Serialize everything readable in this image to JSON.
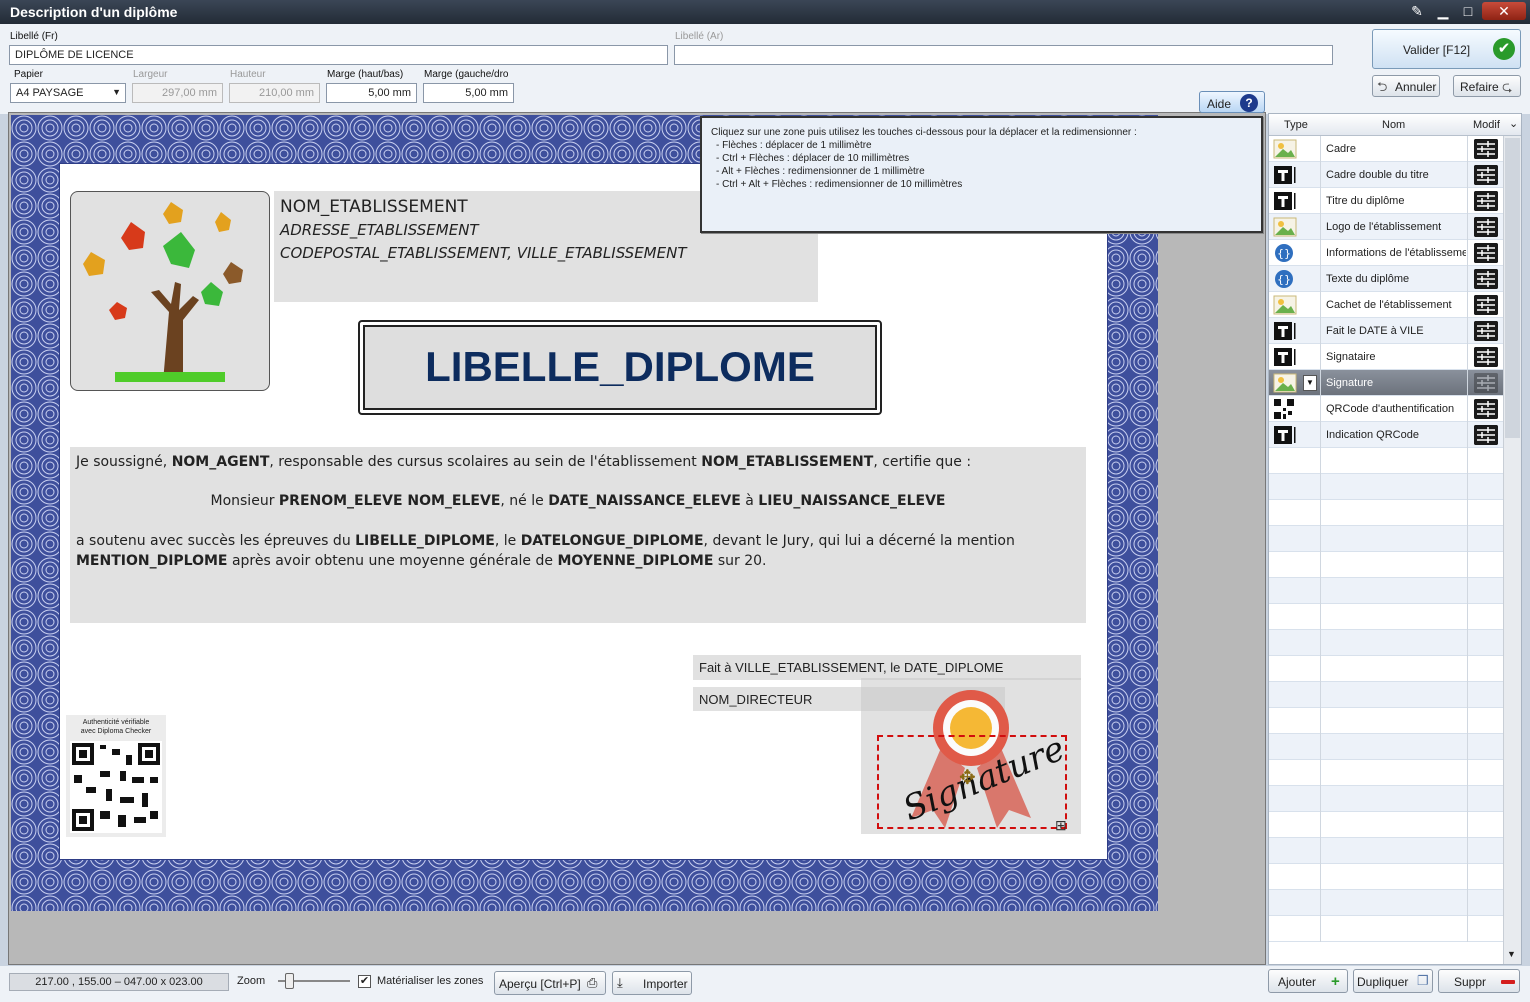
{
  "window": {
    "title": "Description d'un diplôme"
  },
  "form": {
    "label_fr": "Libellé (Fr)",
    "label_fr_value": "DIPLÔME DE LICENCE",
    "label_ar": "Libellé (Ar)",
    "label_ar_value": "",
    "paper_label": "Papier",
    "paper_value": "A4 PAYSAGE",
    "width_label": "Largeur",
    "width_value": "297,00 mm",
    "height_label": "Hauteur",
    "height_value": "210,00 mm",
    "margin_v_label": "Marge (haut/bas)",
    "margin_v_value": "5,00 mm",
    "margin_h_label": "Marge (gauche/dro",
    "margin_h_value": "5,00 mm"
  },
  "actions": {
    "validate": "Valider [F12]",
    "cancel": "Annuler",
    "redo": "Refaire",
    "help": "Aide"
  },
  "help_text": {
    "intro": "Cliquez sur une zone puis utilisez les touches ci-dessous pour la déplacer et la redimensionner :",
    "line1": "- Flèches : déplacer de 1 millimètre",
    "line2": "- Ctrl + Flèches : déplacer de 10 millimètres",
    "line3": "- Alt + Flèches : redimensionner de 1 millimètre",
    "line4": "- Ctrl + Alt + Flèches : redimensionner de 10 millimètres"
  },
  "diploma": {
    "etab_name": "NOM_ETABLISSEMENT",
    "etab_address": "ADRESSE_ETABLISSEMENT",
    "etab_city": "CODEPOSTAL_ETABLISSEMENT, VILLE_ETABLISSEMENT",
    "title": "LIBELLE_DIPLOME",
    "p1_a": "Je soussigné, ",
    "p1_b": "NOM_AGENT",
    "p1_c": ", responsable des cursus scolaires au sein de l'établissement ",
    "p1_d": "NOM_ETABLISSEMENT",
    "p1_e": ", certifie que :",
    "p2_a": "Monsieur ",
    "p2_b": "PRENOM_ELEVE NOM_ELEVE",
    "p2_c": ", né le ",
    "p2_d": "DATE_NAISSANCE_ELEVE",
    "p2_e": " à ",
    "p2_f": "LIEU_NAISSANCE_ELEVE",
    "p3_a": "a soutenu avec succès les épreuves du ",
    "p3_b": "LIBELLE_DIPLOME",
    "p3_c": ", le ",
    "p3_d": "DATELONGUE_DIPLOME",
    "p3_e": ", devant le Jury, qui lui a décerné la mention",
    "p4_a": "MENTION_DIPLOME",
    "p4_b": " après avoir obtenu une moyenne générale de ",
    "p4_c": "MOYENNE_DIPLOME",
    "p4_d": " sur 20.",
    "fait_a": "Fait à VILLE_ETABLISSEMENT, le DATE_DIPLOME",
    "director": "NOM_DIRECTEUR",
    "signature": "Signature",
    "qr_line1": "Authenticité vérifiable",
    "qr_line2": "avec Diploma Checker"
  },
  "zones_table": {
    "headers": {
      "type": "Type",
      "name": "Nom",
      "modif": "Modif"
    },
    "rows": [
      {
        "type": "image",
        "name": "Cadre"
      },
      {
        "type": "text",
        "name": "Cadre double du titre"
      },
      {
        "type": "text",
        "name": "Titre du diplôme"
      },
      {
        "type": "image",
        "name": "Logo de l'établissement"
      },
      {
        "type": "rich",
        "name": "Informations de l'établissemen"
      },
      {
        "type": "rich",
        "name": "Texte du diplôme"
      },
      {
        "type": "image",
        "name": "Cachet de l'établissement"
      },
      {
        "type": "text",
        "name": "Fait le DATE à VILE"
      },
      {
        "type": "text",
        "name": "Signataire"
      },
      {
        "type": "image",
        "name": "Signature",
        "selected": true
      },
      {
        "type": "qr",
        "name": "QRCode d'authentification"
      },
      {
        "type": "text",
        "name": "Indication QRCode"
      }
    ]
  },
  "bottom": {
    "coords": "217.00 , 155.00 – 047.00 x 023.00",
    "zoom_label": "Zoom",
    "zoom_level": 0.1,
    "show_zones_label": "Matérialiser les zones",
    "show_zones_checked": true,
    "preview": "Aperçu [Ctrl+P]",
    "import": "Importer",
    "add": "Ajouter",
    "duplicate": "Dupliquer",
    "delete": "Suppr"
  },
  "colors": {
    "accent": "#2e3d86",
    "title_text": "#0d2c5e",
    "selected_row": "#7b828c"
  }
}
